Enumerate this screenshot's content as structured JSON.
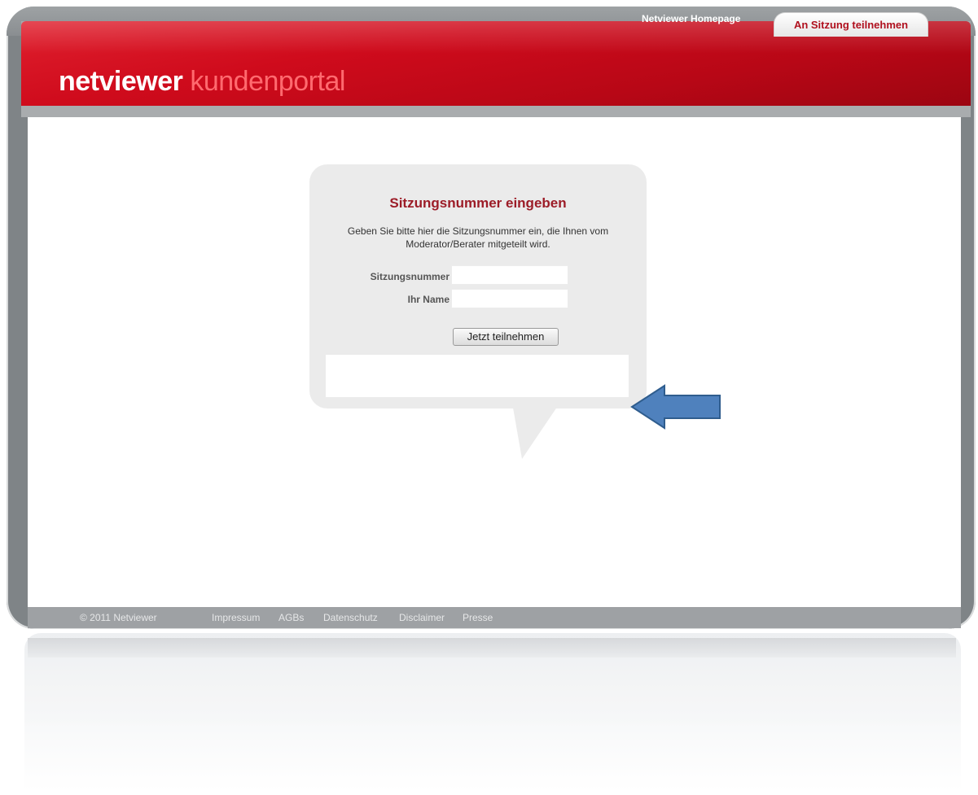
{
  "header": {
    "logo_primary": "netviewer",
    "logo_secondary": "kundenportal",
    "homepage_link": "Netviewer Homepage",
    "join_tab": "An Sitzung teilnehmen"
  },
  "form": {
    "title": "Sitzungsnummer eingeben",
    "description": "Geben Sie bitte hier die Sitzungsnummer ein, die Ihnen vom Moderator/Berater mitgeteilt wird.",
    "session_label": "Sitzungsnummer",
    "session_value": "",
    "name_label": "Ihr Name",
    "name_value": "",
    "submit_label": "Jetzt teilnehmen"
  },
  "footer": {
    "copyright": "© 2011 Netviewer",
    "links": [
      "Impressum",
      "AGBs",
      "Datenschutz",
      "Disclaimer",
      "Presse"
    ]
  },
  "colors": {
    "brand_red": "#cf0b1c",
    "title_red": "#9c1c27",
    "arrow_blue": "#4f81bd"
  },
  "icons": {
    "pointer": "left-arrow-icon"
  }
}
